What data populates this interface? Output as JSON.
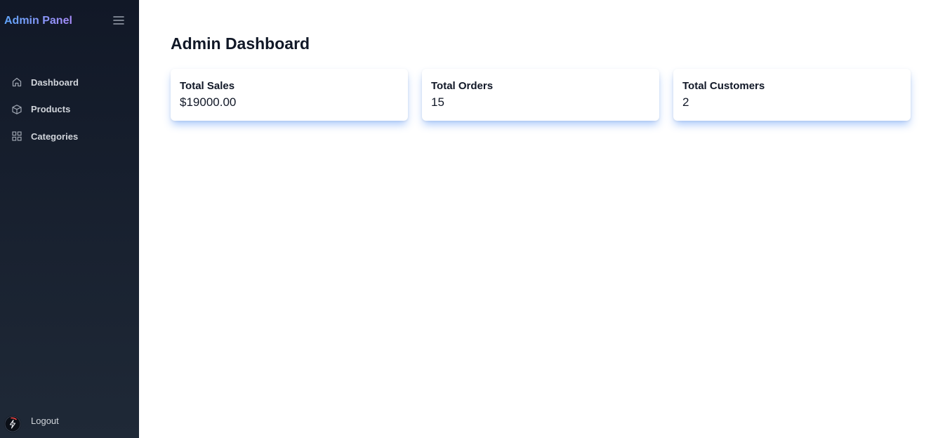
{
  "sidebar": {
    "brand": "Admin Panel",
    "items": [
      {
        "label": "Dashboard",
        "icon": "home-icon"
      },
      {
        "label": "Products",
        "icon": "box-icon"
      },
      {
        "label": "Categories",
        "icon": "grid-icon"
      }
    ],
    "logout_label": "Logout"
  },
  "main": {
    "title": "Admin Dashboard",
    "cards": [
      {
        "title": "Total Sales",
        "value": "$19000.00"
      },
      {
        "title": "Total Orders",
        "value": "15"
      },
      {
        "title": "Total Customers",
        "value": "2"
      }
    ]
  },
  "colors": {
    "sidebar_bg_top": "#111827",
    "sidebar_bg_bottom": "#1f2937",
    "brand_gradient_start": "#60a5fa",
    "brand_gradient_end": "#a78bfa",
    "card_shadow": "#3b82f6"
  }
}
